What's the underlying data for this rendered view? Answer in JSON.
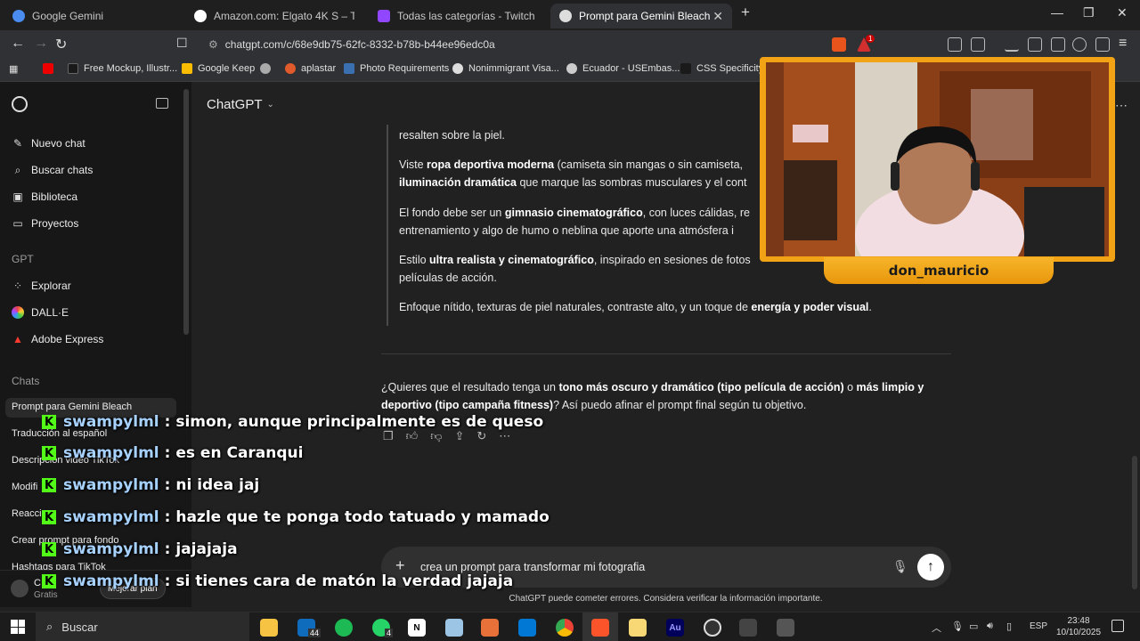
{
  "browser": {
    "tabs": [
      {
        "label": "Google Gemini",
        "active": false
      },
      {
        "label": "Amazon.com: Elgato 4K S – Tarjeta de",
        "active": false
      },
      {
        "label": "Todas las categorías - Twitch",
        "active": false
      },
      {
        "label": "Prompt para Gemini Bleach",
        "active": true
      }
    ],
    "url": "chatgpt.com/c/68e9db75-62fc-8332-b78b-b44ee96edc0a",
    "bookmarks": [
      "Free Mockup, Illustr...",
      "Google Keep",
      "aplastar",
      "Photo Requirements",
      "Nonimmigrant Visa...",
      "Ecuador - USEmbas...",
      "CSS Specificity C..."
    ],
    "notification_badge": "1"
  },
  "sidebar": {
    "items": [
      {
        "label": "Nuevo chat",
        "icon": "edit-icon"
      },
      {
        "label": "Buscar chats",
        "icon": "search-icon"
      },
      {
        "label": "Biblioteca",
        "icon": "library-icon"
      },
      {
        "label": "Proyectos",
        "icon": "folder-icon"
      }
    ],
    "gpt_heading": "GPT",
    "gpts": [
      {
        "label": "Explorar",
        "icon": "grid-icon"
      },
      {
        "label": "DALL·E",
        "icon": "dalle-icon"
      },
      {
        "label": "Adobe Express",
        "icon": "adobe-icon"
      }
    ],
    "chats_heading": "Chats",
    "chats": [
      "Prompt para Gemini Bleach",
      "Traducción al español",
      "Descripción video TikTok",
      "Modifi",
      "Reacci",
      "Crear prompt para fondo",
      "Hashtags para TikTok"
    ],
    "user_plan_button": "Mejorar plan",
    "user_plan": "Gratis",
    "user_initial": "C"
  },
  "main": {
    "model_label": "ChatGPT",
    "paragraphs": {
      "p0": "resalten sobre la piel.",
      "p1a": "Viste ",
      "p1b": "ropa deportiva moderna",
      "p1c": " (camiseta sin mangas o sin camiseta, ",
      "p1d": "iluminación dramática",
      "p1e": " que marque las sombras musculares y el cont",
      "p2a": "El fondo debe ser un ",
      "p2b": "gimnasio cinematográfico",
      "p2c": ", con luces cálidas, re",
      "p2d": "entrenamiento y algo de humo o neblina que aporte una atmósfera i",
      "p3a": "Estilo ",
      "p3b": "ultra realista y cinematográfico",
      "p3c": ", inspirado en sesiones de fotos",
      "p3d": "películas de acción.",
      "p4a": "Enfoque nítido, texturas de piel naturales, contraste alto, y un toque de ",
      "p4b": "energía y poder visual",
      "p4c": ".",
      "q1": "¿Quieres que el resultado tenga un ",
      "q2": "tono más oscuro y dramático (tipo película de acción)",
      "q3": " o ",
      "q4": "más limpio y",
      "q5": "deportivo (tipo campaña fitness)",
      "q6": "? Así puedo afinar el prompt final según tu objetivo."
    },
    "composer_text": "crea un prompt para transformar mi fotografia",
    "disclaimer": "ChatGPT puede cometer errores. Considera verificar la información importante."
  },
  "stream": {
    "streamer_name": "don_mauricio",
    "chat": [
      {
        "user": "swampylml",
        "text": ": simon, aunque principalmente es de queso"
      },
      {
        "user": "swampylml",
        "text": ": es en Caranqui"
      },
      {
        "user": "swampylml",
        "text": ": ni idea jaj"
      },
      {
        "user": "swampylml",
        "text": ": hazle que te ponga todo tatuado y mamado"
      },
      {
        "user": "swampylml",
        "text": ": jajajaja"
      },
      {
        "user": "swampylml",
        "text": ": si tienes cara de matón la verdad jajaja"
      }
    ],
    "badge_letter": "K"
  },
  "taskbar": {
    "search_placeholder": "Buscar",
    "badge_count": "44",
    "whatsapp_count": "4",
    "language": "ESP",
    "time": "23:48",
    "date": "10/10/2025"
  },
  "colors": {
    "sidebar_bg": "#171717",
    "main_bg": "#212121",
    "frame_orange": "#f2a215",
    "kick_green": "#53fc18",
    "chat_user_blue": "#a7d2ff"
  }
}
